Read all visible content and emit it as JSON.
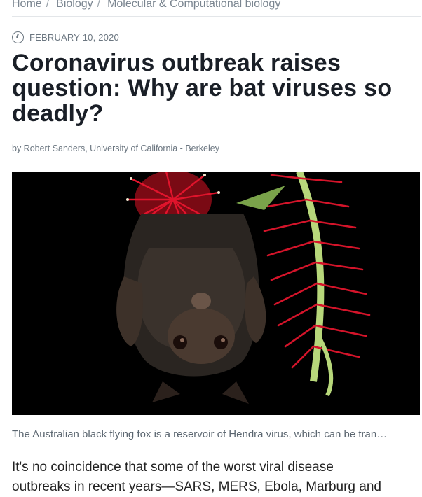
{
  "breadcrumb": {
    "items": [
      "Home",
      "Biology",
      "Molecular & Computational biology"
    ],
    "separator": "/"
  },
  "article": {
    "date": "FEBRUARY 10, 2020",
    "title": "Coronavirus outbreak raises question: Why are bat viruses so deadly?",
    "byline": "by Robert Sanders, University of California - Berkeley",
    "image_caption": "The Australian black flying fox is a reservoir of Hendra virus, which can be tran…",
    "body_first_line": "It's no coincidence that some of the worst viral disease",
    "body_second_line": "outbreaks in recent years—SARS, MERS, Ebola, Marburg and"
  },
  "icons": {
    "date": "clock-icon"
  },
  "colors": {
    "title": "#1a1f27",
    "meta": "#6b7680",
    "flower_red": "#d4142a",
    "flower_green": "#b7d77a"
  }
}
